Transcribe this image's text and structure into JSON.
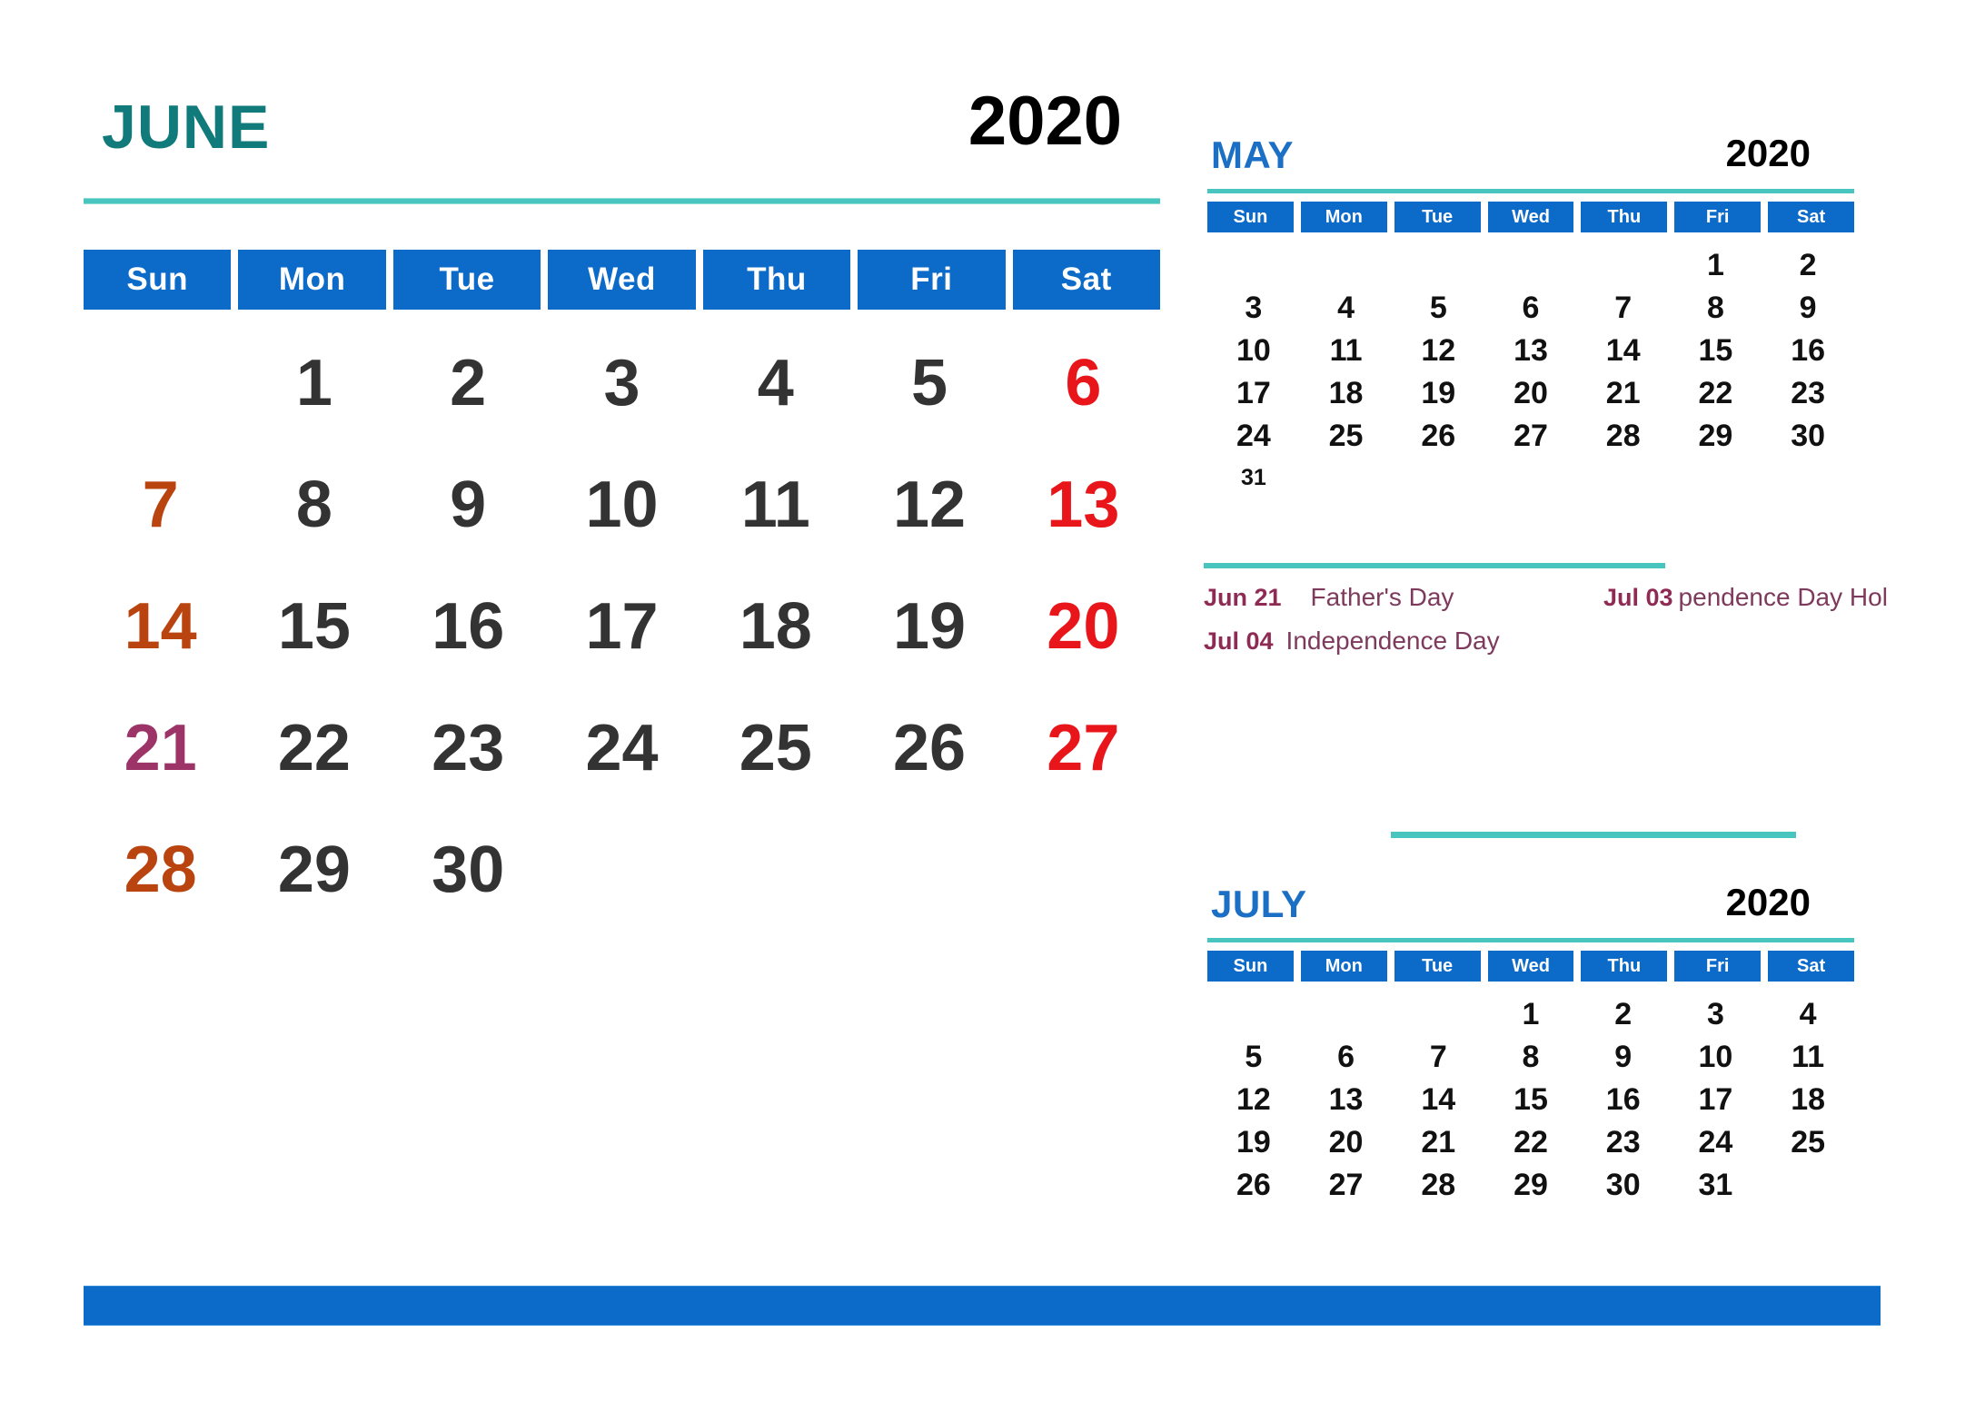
{
  "main": {
    "month": "JUNE",
    "year": "2020",
    "weekday_headers": [
      "Sun",
      "Mon",
      "Tue",
      "Wed",
      "Thu",
      "Fri",
      "Sat"
    ],
    "weeks": [
      [
        {
          "day": "",
          "kind": "empty"
        },
        {
          "day": "1",
          "kind": "normal"
        },
        {
          "day": "2",
          "kind": "normal"
        },
        {
          "day": "3",
          "kind": "normal"
        },
        {
          "day": "4",
          "kind": "normal"
        },
        {
          "day": "5",
          "kind": "normal"
        },
        {
          "day": "6",
          "kind": "sat"
        }
      ],
      [
        {
          "day": "7",
          "kind": "sun"
        },
        {
          "day": "8",
          "kind": "normal"
        },
        {
          "day": "9",
          "kind": "normal"
        },
        {
          "day": "10",
          "kind": "normal"
        },
        {
          "day": "11",
          "kind": "normal"
        },
        {
          "day": "12",
          "kind": "normal"
        },
        {
          "day": "13",
          "kind": "sat"
        }
      ],
      [
        {
          "day": "14",
          "kind": "sun"
        },
        {
          "day": "15",
          "kind": "normal"
        },
        {
          "day": "16",
          "kind": "normal"
        },
        {
          "day": "17",
          "kind": "normal"
        },
        {
          "day": "18",
          "kind": "normal"
        },
        {
          "day": "19",
          "kind": "normal"
        },
        {
          "day": "20",
          "kind": "sat"
        }
      ],
      [
        {
          "day": "21",
          "kind": "hol"
        },
        {
          "day": "22",
          "kind": "normal"
        },
        {
          "day": "23",
          "kind": "normal"
        },
        {
          "day": "24",
          "kind": "normal"
        },
        {
          "day": "25",
          "kind": "normal"
        },
        {
          "day": "26",
          "kind": "normal"
        },
        {
          "day": "27",
          "kind": "sat"
        }
      ],
      [
        {
          "day": "28",
          "kind": "sun"
        },
        {
          "day": "29",
          "kind": "normal"
        },
        {
          "day": "30",
          "kind": "normal"
        },
        {
          "day": "",
          "kind": "empty"
        },
        {
          "day": "",
          "kind": "empty"
        },
        {
          "day": "",
          "kind": "empty"
        },
        {
          "day": "",
          "kind": "empty"
        }
      ]
    ]
  },
  "prev_month": {
    "month": "MAY",
    "year": "2020",
    "weekday_headers": [
      "Sun",
      "Mon",
      "Tue",
      "Wed",
      "Thu",
      "Fri",
      "Sat"
    ],
    "weeks": [
      [
        {
          "day": "",
          "kind": "empty"
        },
        {
          "day": "",
          "kind": "empty"
        },
        {
          "day": "",
          "kind": "empty"
        },
        {
          "day": "",
          "kind": "empty"
        },
        {
          "day": "",
          "kind": "empty"
        },
        {
          "day": "1",
          "kind": "normal"
        },
        {
          "day": "2",
          "kind": "normal"
        }
      ],
      [
        {
          "day": "3",
          "kind": "normal"
        },
        {
          "day": "4",
          "kind": "normal"
        },
        {
          "day": "5",
          "kind": "normal"
        },
        {
          "day": "6",
          "kind": "normal"
        },
        {
          "day": "7",
          "kind": "normal"
        },
        {
          "day": "8",
          "kind": "normal"
        },
        {
          "day": "9",
          "kind": "normal"
        }
      ],
      [
        {
          "day": "10",
          "kind": "normal"
        },
        {
          "day": "11",
          "kind": "normal"
        },
        {
          "day": "12",
          "kind": "normal"
        },
        {
          "day": "13",
          "kind": "normal"
        },
        {
          "day": "14",
          "kind": "normal"
        },
        {
          "day": "15",
          "kind": "normal"
        },
        {
          "day": "16",
          "kind": "normal"
        }
      ],
      [
        {
          "day": "17",
          "kind": "normal"
        },
        {
          "day": "18",
          "kind": "normal"
        },
        {
          "day": "19",
          "kind": "normal"
        },
        {
          "day": "20",
          "kind": "normal"
        },
        {
          "day": "21",
          "kind": "normal"
        },
        {
          "day": "22",
          "kind": "normal"
        },
        {
          "day": "23",
          "kind": "normal"
        }
      ],
      [
        {
          "day": "24",
          "kind": "normal"
        },
        {
          "day": "25",
          "kind": "normal"
        },
        {
          "day": "26",
          "kind": "normal"
        },
        {
          "day": "27",
          "kind": "normal"
        },
        {
          "day": "28",
          "kind": "normal"
        },
        {
          "day": "29",
          "kind": "normal"
        },
        {
          "day": "30",
          "kind": "normal"
        }
      ],
      [
        {
          "day": "31",
          "kind": "small"
        },
        {
          "day": "",
          "kind": "empty"
        },
        {
          "day": "",
          "kind": "empty"
        },
        {
          "day": "",
          "kind": "empty"
        },
        {
          "day": "",
          "kind": "empty"
        },
        {
          "day": "",
          "kind": "empty"
        },
        {
          "day": "",
          "kind": "empty"
        }
      ]
    ]
  },
  "next_month": {
    "month": "JULY",
    "year": "2020",
    "weekday_headers": [
      "Sun",
      "Mon",
      "Tue",
      "Wed",
      "Thu",
      "Fri",
      "Sat"
    ],
    "weeks": [
      [
        {
          "day": "",
          "kind": "empty"
        },
        {
          "day": "",
          "kind": "empty"
        },
        {
          "day": "",
          "kind": "empty"
        },
        {
          "day": "1",
          "kind": "normal"
        },
        {
          "day": "2",
          "kind": "normal"
        },
        {
          "day": "3",
          "kind": "normal"
        },
        {
          "day": "4",
          "kind": "normal"
        }
      ],
      [
        {
          "day": "5",
          "kind": "normal"
        },
        {
          "day": "6",
          "kind": "normal"
        },
        {
          "day": "7",
          "kind": "normal"
        },
        {
          "day": "8",
          "kind": "normal"
        },
        {
          "day": "9",
          "kind": "normal"
        },
        {
          "day": "10",
          "kind": "normal"
        },
        {
          "day": "11",
          "kind": "normal"
        }
      ],
      [
        {
          "day": "12",
          "kind": "normal"
        },
        {
          "day": "13",
          "kind": "normal"
        },
        {
          "day": "14",
          "kind": "normal"
        },
        {
          "day": "15",
          "kind": "normal"
        },
        {
          "day": "16",
          "kind": "normal"
        },
        {
          "day": "17",
          "kind": "normal"
        },
        {
          "day": "18",
          "kind": "normal"
        }
      ],
      [
        {
          "day": "19",
          "kind": "normal"
        },
        {
          "day": "20",
          "kind": "normal"
        },
        {
          "day": "21",
          "kind": "normal"
        },
        {
          "day": "22",
          "kind": "normal"
        },
        {
          "day": "23",
          "kind": "normal"
        },
        {
          "day": "24",
          "kind": "normal"
        },
        {
          "day": "25",
          "kind": "normal"
        }
      ],
      [
        {
          "day": "26",
          "kind": "normal"
        },
        {
          "day": "27",
          "kind": "normal"
        },
        {
          "day": "28",
          "kind": "normal"
        },
        {
          "day": "29",
          "kind": "normal"
        },
        {
          "day": "30",
          "kind": "normal"
        },
        {
          "day": "31",
          "kind": "normal"
        },
        {
          "day": "",
          "kind": "empty"
        }
      ]
    ]
  },
  "holidays": {
    "rows": [
      [
        {
          "date": "Jun 21",
          "name": "Father's Day",
          "pos": "hol-left-a"
        },
        {
          "date": "Jul 03",
          "name": "pendence Day Hol",
          "pos": "hol-right-a"
        }
      ],
      [
        {
          "date": "Jul 04",
          "name": "Independence Day",
          "pos": "hol-left-b"
        }
      ]
    ]
  },
  "colors": {
    "header_blue": "#0c6ac9",
    "teal_rule": "#49c5c0",
    "main_month_teal": "#117b7b",
    "side_month_blue": "#1b6fc4",
    "saturday_red": "#e8161a",
    "sunday_brown": "#b9440f",
    "holiday_purple": "#9c3468",
    "holiday_text": "#8e2b55",
    "day_number": "#333333"
  }
}
